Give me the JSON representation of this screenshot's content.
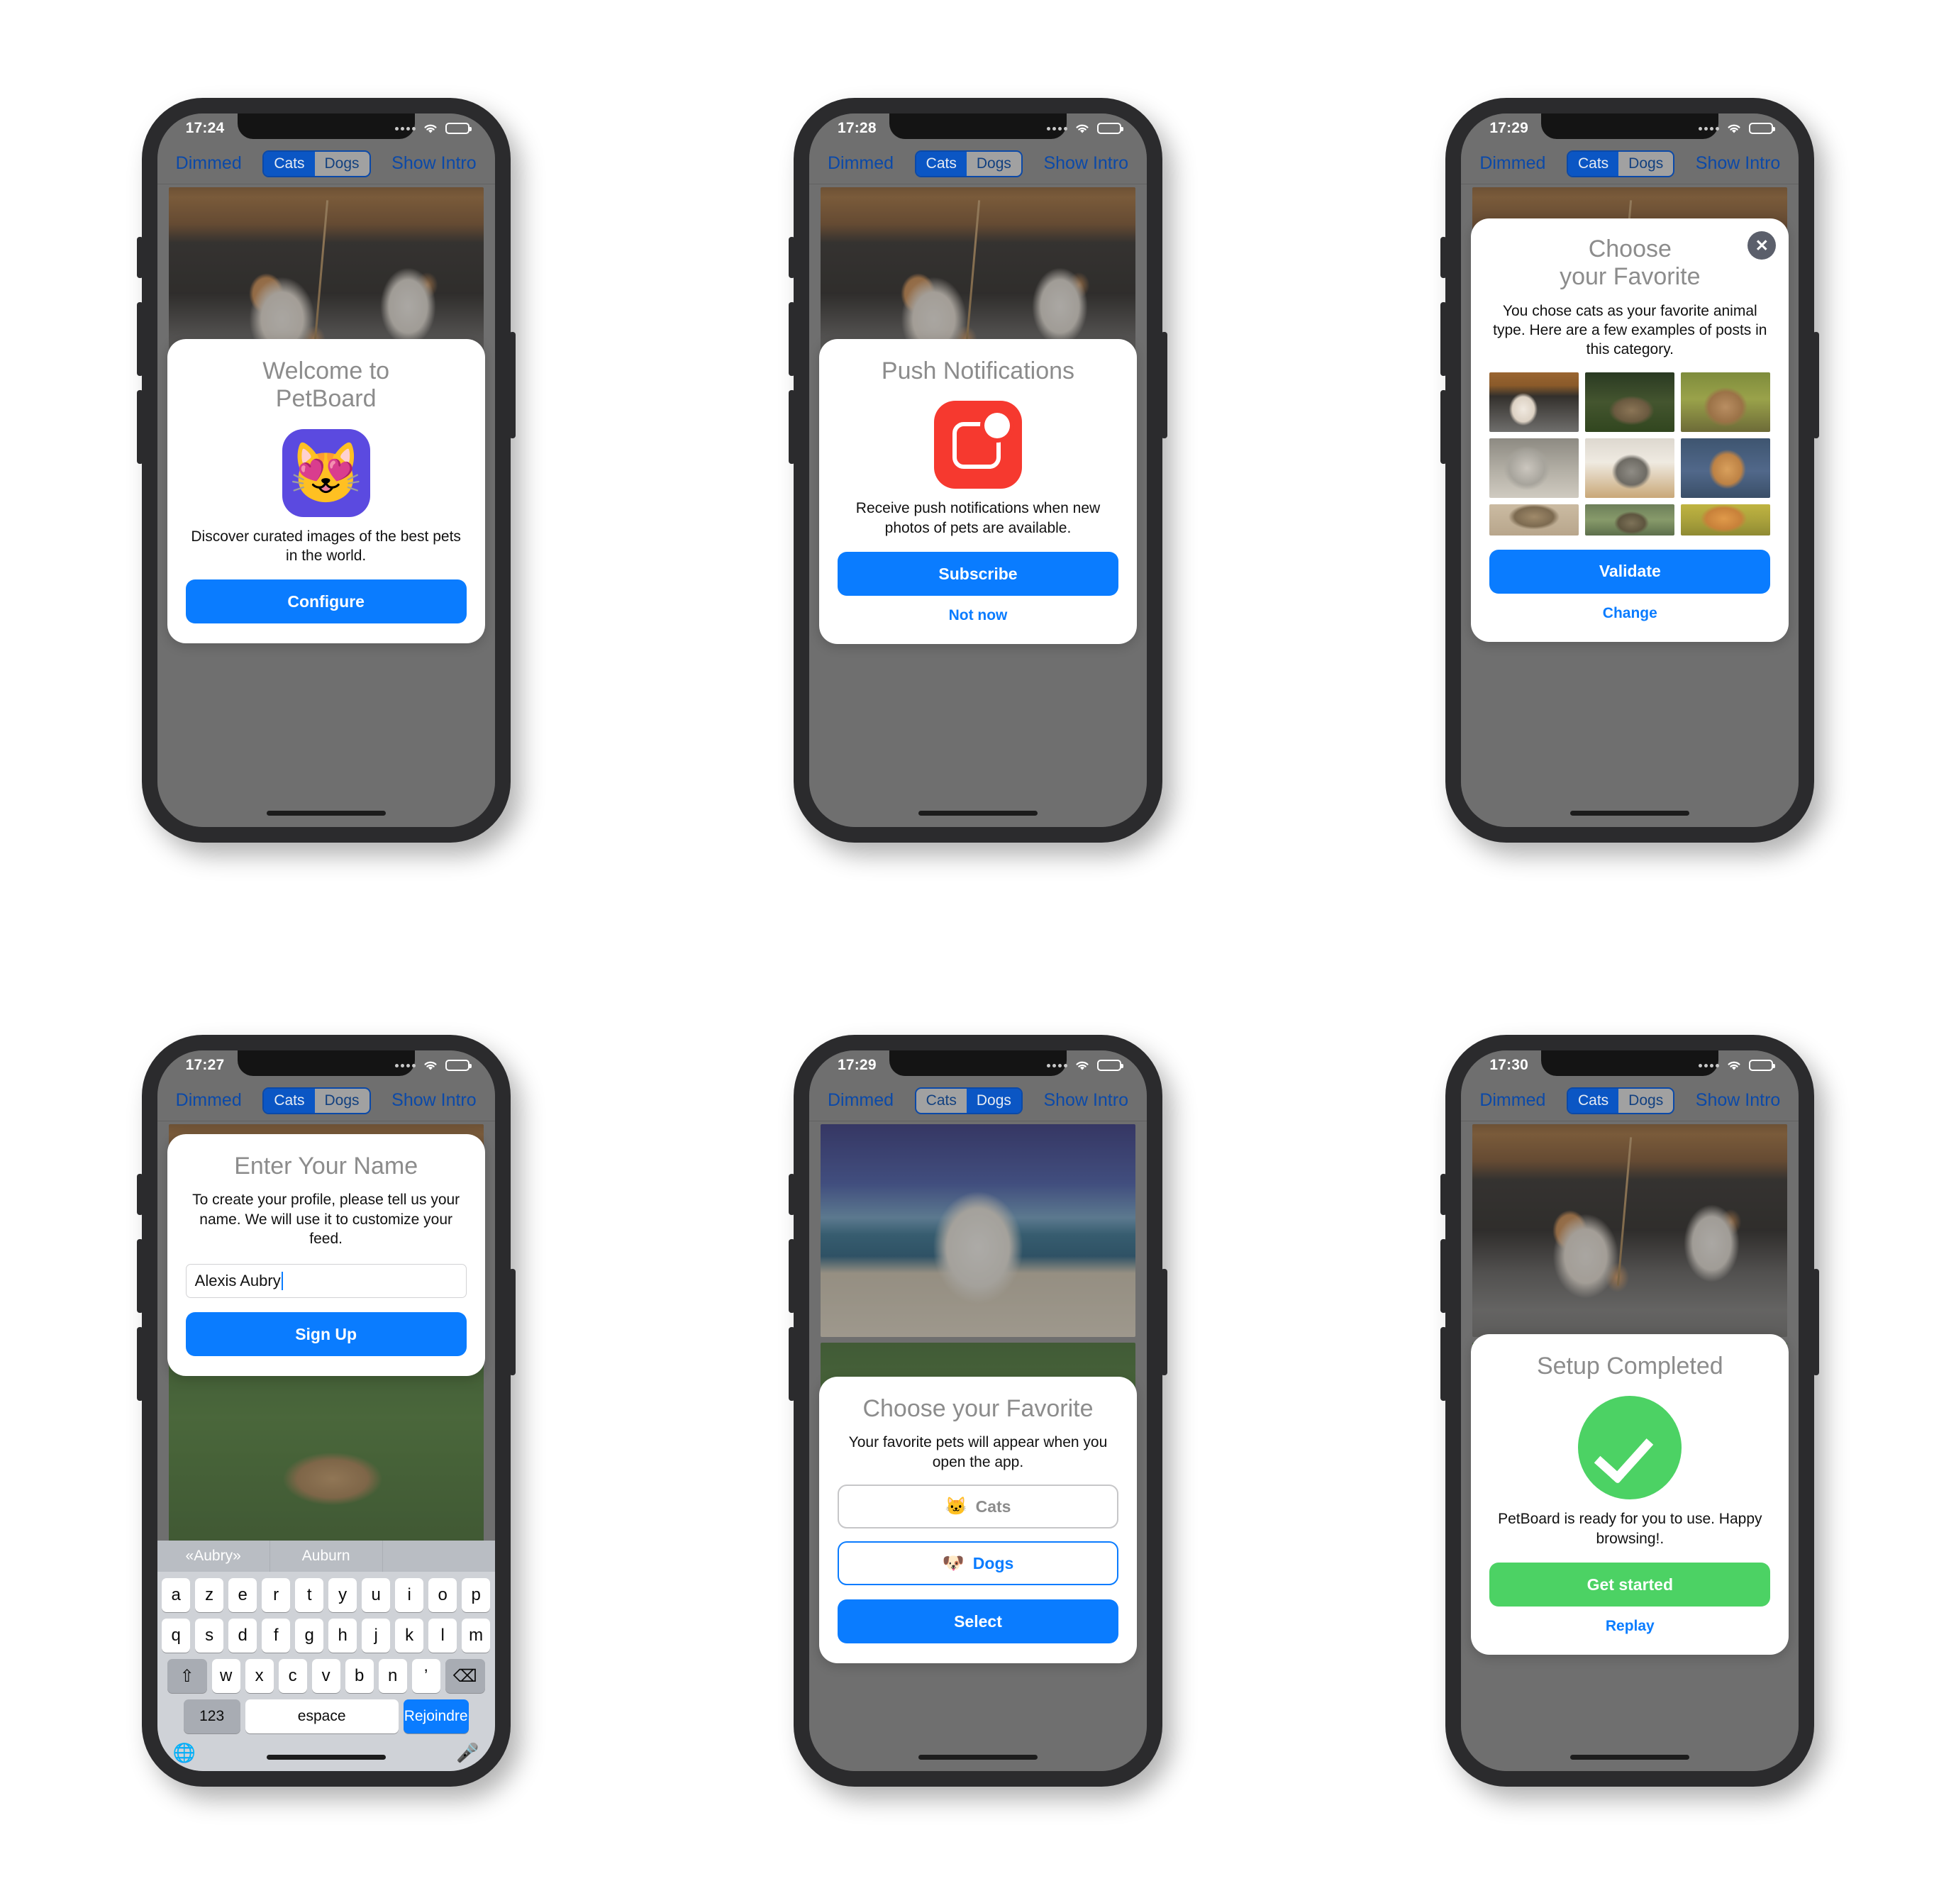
{
  "app": {
    "name": "PetBoard"
  },
  "nav": {
    "dimmed_label": "Dimmed",
    "show_intro_label": "Show Intro",
    "segment_cats": "Cats",
    "segment_dogs": "Dogs"
  },
  "colors": {
    "accent_blue": "#0a7cff",
    "nav_blue": "#0b49a8",
    "segment_blue": "#0b56c4",
    "success_green": "#4cd264",
    "push_red": "#f6392f",
    "app_tile_purple": "#5b4ae0",
    "title_grey": "#8c8c8c"
  },
  "phones": [
    {
      "id": "welcome",
      "status": {
        "time": "17:24",
        "wifi": "wifi-icon",
        "battery": "battery-low-icon"
      },
      "segment_selected": "Cats",
      "card": {
        "title": "Welcome to\nPetBoard",
        "title_line1": "Welcome to",
        "title_line2": "PetBoard",
        "icon": "cat-heart-eyes-emoji",
        "icon_glyph": "😻",
        "body": "Discover curated images of the best pets in the world.",
        "primary_button": "Configure"
      }
    },
    {
      "id": "push",
      "status": {
        "time": "17:28",
        "wifi": "wifi-icon",
        "battery": "battery-low-icon"
      },
      "segment_selected": "Cats",
      "card": {
        "title": "Push Notifications",
        "icon": "push-notification-icon",
        "body": "Receive push notifications when new photos of pets are available.",
        "primary_button": "Subscribe",
        "secondary_button": "Not now"
      }
    },
    {
      "id": "favorite-preview",
      "status": {
        "time": "17:29",
        "wifi": "wifi-icon",
        "battery": "battery-low-icon"
      },
      "segment_selected": "Cats",
      "card": {
        "title_line1": "Choose",
        "title_line2": "your Favorite",
        "close_label": "✕",
        "body": "You chose cats as your favorite animal type. Here are a few examples of posts in this category.",
        "thumbnails": [
          "cat-kittens-in-shoe",
          "cat-tabby-sleeping",
          "cat-ginger-longhair",
          "cat-yellow-eye-closeup",
          "cat-silver-tabby-on-rug",
          "cat-orange-with-leash",
          "cat-tabby-paws",
          "cat-tabby-in-garden",
          "cat-ginger-by-fence"
        ],
        "primary_button": "Validate",
        "secondary_button": "Change"
      }
    },
    {
      "id": "enter-name",
      "status": {
        "time": "17:27",
        "wifi": "wifi-icon",
        "battery": "battery-low-icon"
      },
      "segment_selected": "Cats",
      "card": {
        "title": "Enter Your Name",
        "body": "To create your profile, please tell us your name. We will use it to customize your feed.",
        "input_value": "Alexis Aubry",
        "input_placeholder": "",
        "primary_button": "Sign Up"
      },
      "keyboard": {
        "suggestions": [
          "«Aubry»",
          "Auburn",
          ""
        ],
        "row1": [
          "a",
          "z",
          "e",
          "r",
          "t",
          "y",
          "u",
          "i",
          "o",
          "p"
        ],
        "row2": [
          "q",
          "s",
          "d",
          "f",
          "g",
          "h",
          "j",
          "k",
          "l",
          "m"
        ],
        "row3_shift": "shift-icon",
        "row3": [
          "w",
          "x",
          "c",
          "v",
          "b",
          "n",
          "’"
        ],
        "row3_delete": "delete-icon",
        "numbers_key": "123",
        "space_key": "espace",
        "go_key": "Rejoindre",
        "globe_key": "globe-icon",
        "mic_key": "microphone-icon"
      }
    },
    {
      "id": "choose-favorite",
      "status": {
        "time": "17:29",
        "wifi": "wifi-icon",
        "battery": "battery-low-icon"
      },
      "segment_selected": "Dogs",
      "card": {
        "title": "Choose your Favorite",
        "body": "Your favorite pets will appear when you open the app.",
        "options": [
          {
            "label": "Cats",
            "emoji": "🐱",
            "selected": false
          },
          {
            "label": "Dogs",
            "emoji": "🐶",
            "selected": true
          }
        ],
        "primary_button": "Select"
      }
    },
    {
      "id": "setup-completed",
      "status": {
        "time": "17:30",
        "wifi": "wifi-icon",
        "battery": "battery-low-icon"
      },
      "segment_selected": "Cats",
      "card": {
        "title": "Setup Completed",
        "icon": "success-check-icon",
        "body": "PetBoard is ready for you to use. Happy browsing!.",
        "primary_button": "Get started",
        "secondary_button": "Replay"
      }
    }
  ]
}
